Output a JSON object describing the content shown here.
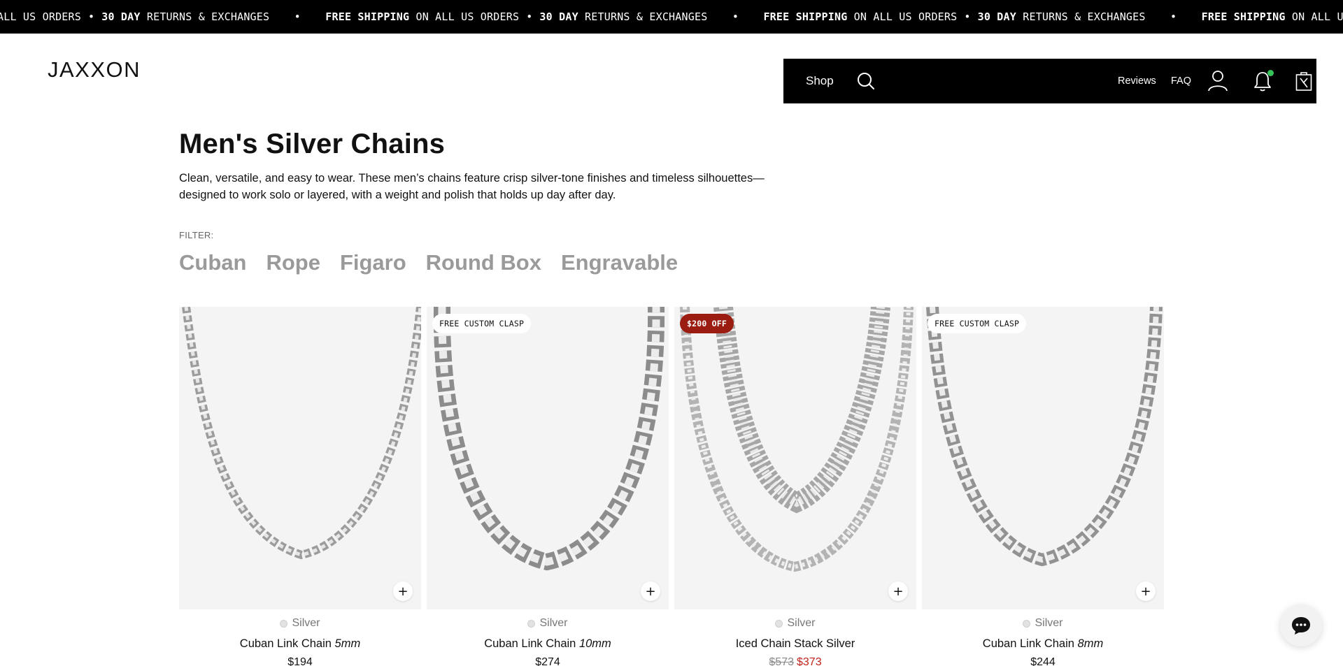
{
  "announcement": {
    "bold_1": "FREE SHIPPING",
    "text_1": "ON ALL US ORDERS",
    "bold_2": "30 DAY",
    "text_2": "RETURNS & EXCHANGES",
    "partial_lead": "ALL US ORDERS"
  },
  "header": {
    "logo": "JAXXON",
    "nav": {
      "shop": "Shop",
      "reviews": "Reviews",
      "faq": "FAQ"
    },
    "icons": [
      "search-icon",
      "account-icon",
      "bell-icon",
      "cart-icon"
    ],
    "notification_dot_color": "#36c45a"
  },
  "page": {
    "title": "Men's Silver Chains",
    "description": "Clean, versatile, and easy to wear. These men’s chains feature crisp silver-tone finishes and timeless silhouettes—designed to work solo or layered, with a weight and polish that holds up day after day."
  },
  "filters": {
    "label": "FILTER:",
    "options": [
      "Cuban",
      "Rope",
      "Figaro",
      "Round Box",
      "Engravable"
    ]
  },
  "products": [
    {
      "badge": "",
      "badge_type": "",
      "swatch": "Silver",
      "name": "Cuban Link Chain",
      "variant": "5mm",
      "price_old": "",
      "price": "$194"
    },
    {
      "badge": "FREE CUSTOM CLASP",
      "badge_type": "light",
      "swatch": "Silver",
      "name": "Cuban Link Chain",
      "variant": "10mm",
      "price_old": "",
      "price": "$274"
    },
    {
      "badge": "$200 OFF",
      "badge_type": "sale",
      "swatch": "Silver",
      "name": "Iced Chain Stack Silver",
      "variant": "",
      "price_old": "$573",
      "price": "$373"
    },
    {
      "badge": "FREE CUSTOM CLASP",
      "badge_type": "light",
      "swatch": "Silver",
      "name": "Cuban Link Chain",
      "variant": "8mm",
      "price_old": "",
      "price": "$244"
    }
  ],
  "add_label": "+",
  "colors": {
    "sale_badge": "#9b1d12",
    "sale_price": "#c0211b",
    "filter_text": "#9a9a9a"
  }
}
